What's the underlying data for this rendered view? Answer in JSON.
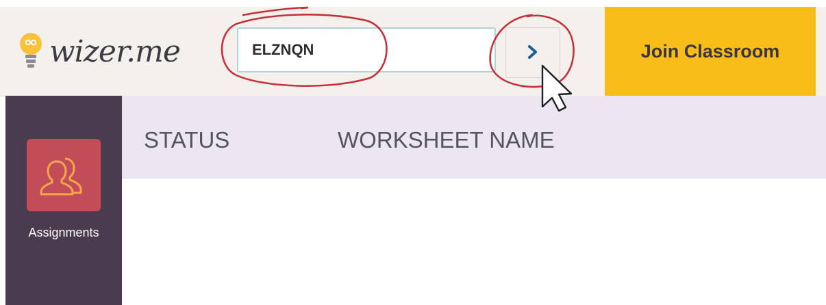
{
  "header": {
    "logo_text": "wizer.me",
    "code_input": {
      "value": "ELZNQN",
      "placeholder": ""
    },
    "go_icon": "chevron-right-icon",
    "join_label": "Join Classroom"
  },
  "sidebar": {
    "items": [
      {
        "label": "Assignments",
        "icon": "users-icon"
      }
    ]
  },
  "table": {
    "columns": [
      "STATUS",
      "WORKSHEET NAME"
    ]
  },
  "colors": {
    "topbar": "#f4f1ec",
    "accent_yellow": "#f8bd16",
    "sidebar": "#4a3b4e",
    "nav_tile": "#c24d58",
    "annotation_red": "#c4303c",
    "chevron_blue": "#1f5e93"
  }
}
